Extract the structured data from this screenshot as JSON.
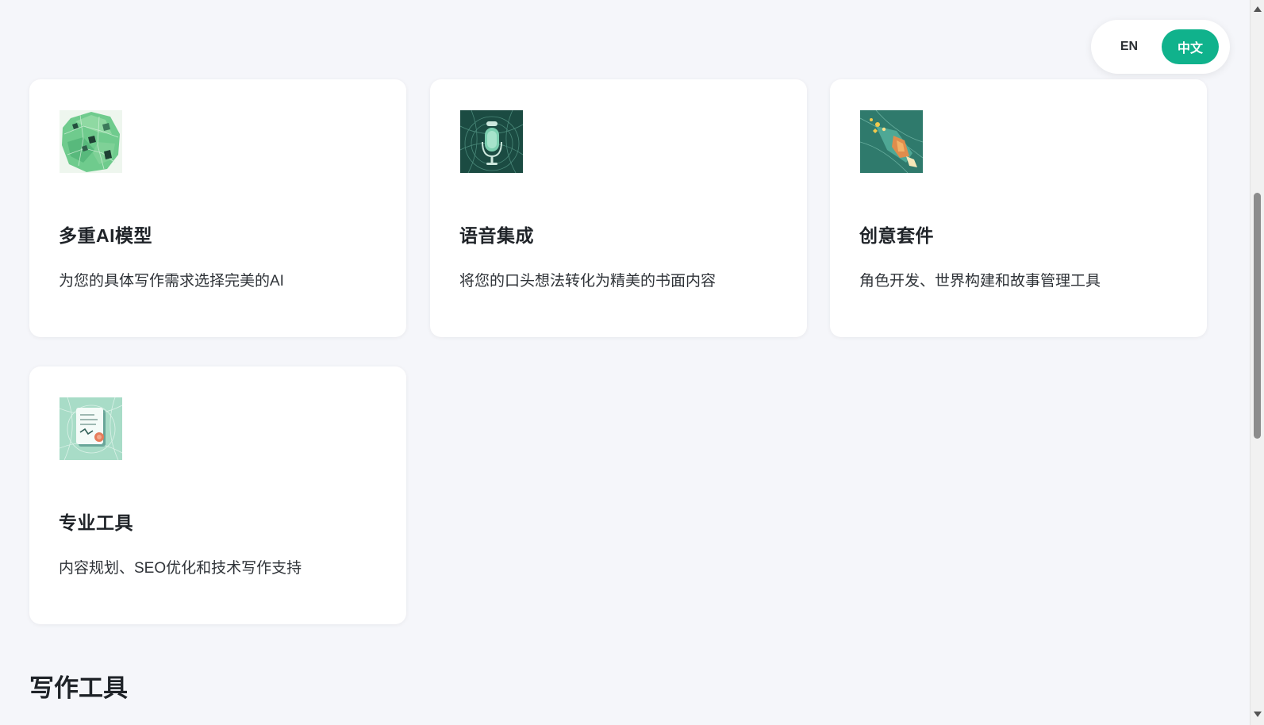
{
  "language_switch": {
    "en_label": "EN",
    "zh_label": "中文",
    "active": "zh"
  },
  "features": [
    {
      "title": "多重AI模型",
      "description": "为您的具体写作需求选择完美的AI",
      "icon": "ai-models-icon"
    },
    {
      "title": "语音集成",
      "description": "将您的口头想法转化为精美的书面内容",
      "icon": "microphone-icon"
    },
    {
      "title": "创意套件",
      "description": "角色开发、世界构建和故事管理工具",
      "icon": "creative-rocket-icon"
    },
    {
      "title": "专业工具",
      "description": "内容规划、SEO优化和技术写作支持",
      "icon": "document-icon"
    }
  ],
  "next_section": {
    "title": "写作工具"
  },
  "colors": {
    "accent": "#10b28c",
    "background": "#f5f6fa",
    "card": "#ffffff"
  }
}
